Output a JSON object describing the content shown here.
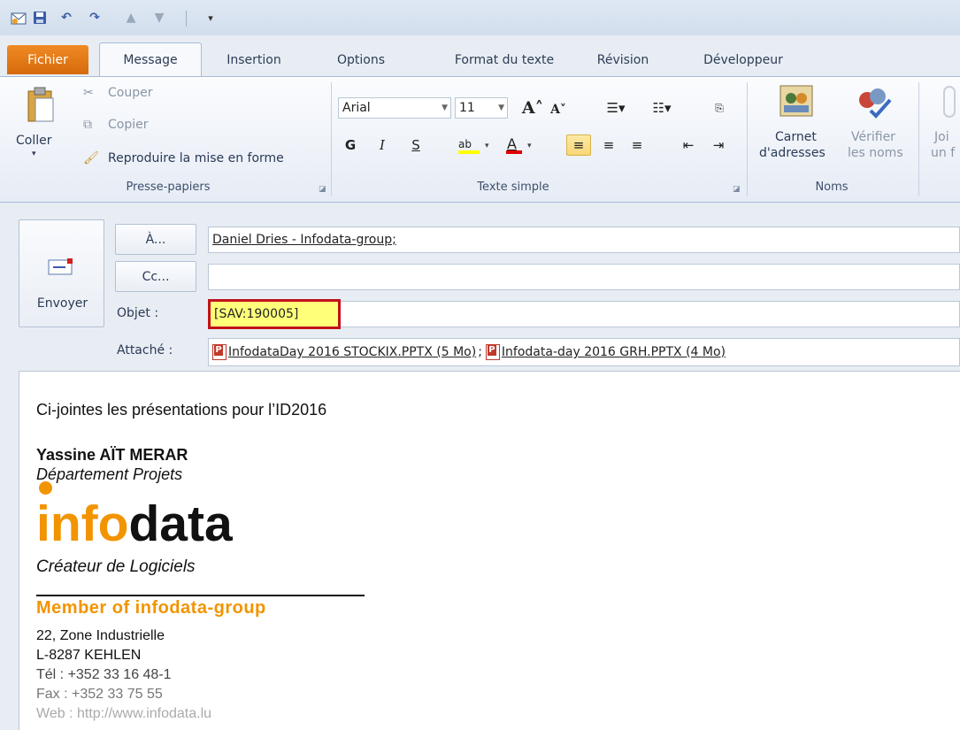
{
  "qat": {
    "icons": [
      "outlook-icon",
      "save-icon",
      "undo-icon",
      "redo-icon",
      "up-arrow-icon",
      "down-arrow-icon",
      "customize-icon"
    ]
  },
  "tabs": [
    "Fichier",
    "Message",
    "Insertion",
    "Options",
    "Format du texte",
    "Révision",
    "Développeur"
  ],
  "ribbon": {
    "clipboard": {
      "paste": "Coller",
      "cut": "Couper",
      "copy": "Copier",
      "format_painter": "Reproduire la mise en forme",
      "label": "Presse-papiers"
    },
    "text": {
      "font": "Arial",
      "size": "11",
      "bold": "G",
      "italic": "I",
      "underline": "S",
      "label": "Texte simple"
    },
    "names": {
      "address_book_1": "Carnet",
      "address_book_2": "d'adresses",
      "check_names_1": "Vérifier",
      "check_names_2": "les noms",
      "label": "Noms"
    },
    "include": {
      "attach_1": "Joi",
      "attach_2": "un f"
    }
  },
  "compose": {
    "send": "Envoyer",
    "to_btn": "À...",
    "cc_btn": "Cc...",
    "subject_label": "Objet :",
    "attached_label": "Attaché :",
    "to_value": "Daniel Dries - Infodata-group;",
    "cc_value": "",
    "subject_value": "[SAV:190005]",
    "attachments": [
      "InfodataDay 2016 STOCKIX.PPTX (5 Mo)",
      "Infodata-day 2016 GRH.PPTX (4 Mo)"
    ]
  },
  "body": {
    "intro": "Ci-jointes les présentations pour l’ID2016",
    "name": "Yassine AÏT MERAR",
    "dept": "Département Projets",
    "logo_info": "info",
    "logo_data": "data",
    "tagline": "Créateur de Logiciels",
    "member": "Member of infodata-group",
    "addr1": "22, Zone Industrielle",
    "addr2": "L-8287 KEHLEN",
    "tel": "Tél : +352 33 16 48-1",
    "fax": "Fax : +352 33 75 55",
    "web": "Web : http://www.infodata.lu"
  },
  "colors": {
    "accent_orange": "#f29400",
    "highlight_yellow": "#ffff7a",
    "highlight_border": "#c0121a"
  }
}
